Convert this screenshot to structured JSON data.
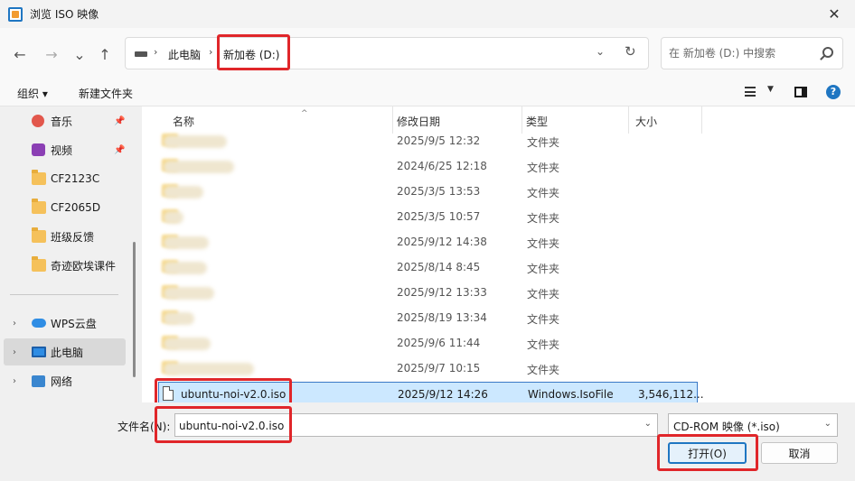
{
  "window": {
    "title": "浏览 ISO 映像",
    "close_glyph": "✕"
  },
  "nav": {
    "back_glyph": "←",
    "forward_glyph": "→",
    "recent_glyph": "⌄",
    "up_glyph": "↑",
    "breadcrumb": [
      "此电脑",
      "新加卷 (D:)"
    ],
    "refresh_glyph": "↻",
    "dropdown_glyph": "⌄"
  },
  "search": {
    "placeholder": "在 新加卷 (D:) 中搜索"
  },
  "commandbar": {
    "organize": "组织 ▾",
    "new_folder": "新建文件夹",
    "help": "?"
  },
  "sidebar": {
    "items": [
      {
        "label": "音乐",
        "icon": "music-icon",
        "pinned": true
      },
      {
        "label": "视频",
        "icon": "video-icon",
        "pinned": true
      },
      {
        "label": "CF2123C",
        "icon": "folder-icon"
      },
      {
        "label": "CF2065D",
        "icon": "folder-icon"
      },
      {
        "label": "班级反馈",
        "icon": "folder-icon"
      },
      {
        "label": "奇迹欧埃课件",
        "icon": "folder-icon"
      },
      {
        "label": "WPS云盘",
        "icon": "cloud-icon",
        "expandable": true
      },
      {
        "label": "此电脑",
        "icon": "pc-icon",
        "expandable": true,
        "selected": true
      },
      {
        "label": "网络",
        "icon": "network-icon",
        "expandable": true
      }
    ],
    "pin_glyph": "📌",
    "expand_glyph": "›"
  },
  "columns": {
    "name": "名称",
    "modified": "修改日期",
    "type": "类型",
    "size": "大小"
  },
  "rows": [
    {
      "date": "2025/9/5 12:32",
      "type": "文件夹"
    },
    {
      "date": "2024/6/25 12:18",
      "type": "文件夹"
    },
    {
      "date": "2025/3/5 13:53",
      "type": "文件夹"
    },
    {
      "date": "2025/3/5 10:57",
      "type": "文件夹"
    },
    {
      "date": "2025/9/12 14:38",
      "type": "文件夹"
    },
    {
      "date": "2025/8/14 8:45",
      "type": "文件夹"
    },
    {
      "date": "2025/9/12 13:33",
      "type": "文件夹"
    },
    {
      "date": "2025/8/19 13:34",
      "type": "文件夹"
    },
    {
      "date": "2025/9/6 11:44",
      "type": "文件夹"
    },
    {
      "date": "2025/9/7 10:15",
      "type": "文件夹"
    }
  ],
  "selected_file": {
    "name": "ubuntu-noi-v2.0.iso",
    "date": "2025/9/12 14:26",
    "type": "Windows.IsoFile",
    "size": "3,546,112..."
  },
  "bottom": {
    "filename_label": "文件名(N):",
    "filename_value": "ubuntu-noi-v2.0.iso",
    "filter_value": "CD-ROM 映像 (*.iso)",
    "open_label": "打开(O)",
    "cancel_label": "取消"
  },
  "colors": {
    "accent": "#1f76c2",
    "highlight": "#e0262a",
    "selection": "#cce8ff"
  }
}
